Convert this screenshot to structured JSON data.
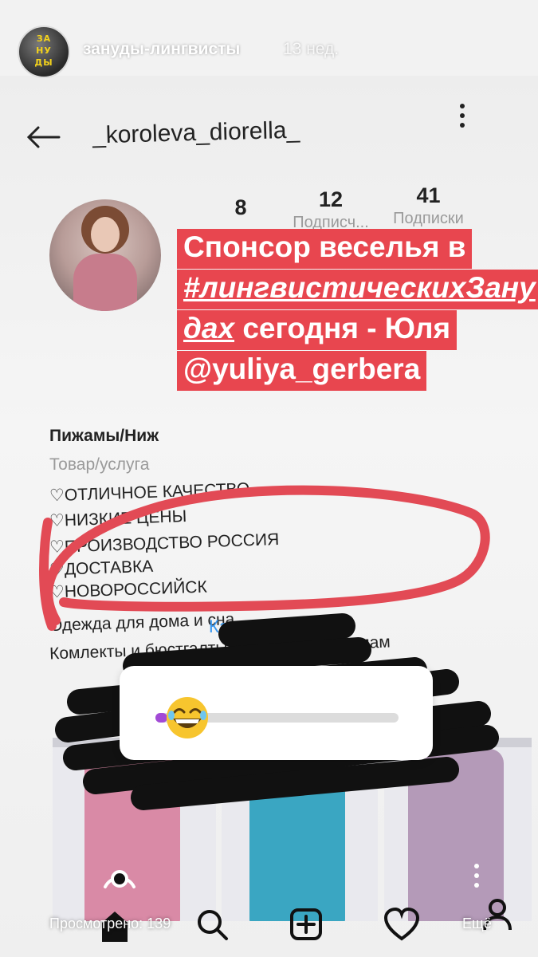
{
  "story": {
    "username": "зануды-лингвисты",
    "time_ago": "13 нед.",
    "avatar_text": [
      "ЗА",
      "НУ",
      "ДЫ"
    ]
  },
  "profile": {
    "username": "_koroleva_diorella_",
    "stats": [
      {
        "num": "8",
        "label": ""
      },
      {
        "num": "12",
        "label": "Подписч..."
      },
      {
        "num": "41",
        "label": "Подписки"
      }
    ],
    "bio": {
      "category": "Пижамы/Ниж",
      "subtype": "Товар/услуга",
      "lines": [
        "♡ОТЛИЧНОЕ КАЧЕСТВО",
        "♡НИЗКИЕ ЦЕНЫ",
        "♡ПРОИЗВОДСТВО РОССИЯ",
        "♡ДОСТАВКА",
        "♡НОВОРОССИЙСК",
        "Одежда для дома и сна.",
        "Комлекты и бюстгалтыры для будущих мам"
      ]
    },
    "call_link": "Как позвонить"
  },
  "sticker": {
    "lines": [
      "Спонсор веселья в",
      "#лингвистическихЗану",
      "дах",
      "сегодня - Юля",
      "@yuliya_gerbera"
    ]
  },
  "slider": {
    "emoji": "laughing-face",
    "value": 0.05,
    "accent": "#a24ad6"
  },
  "footer": {
    "seen_label": "Просмотрено: 139",
    "more_label": "Ещё"
  },
  "colors": {
    "sticker_bg": "#e8464f",
    "circle_stroke": "#e24a55",
    "link": "#3897f0"
  }
}
